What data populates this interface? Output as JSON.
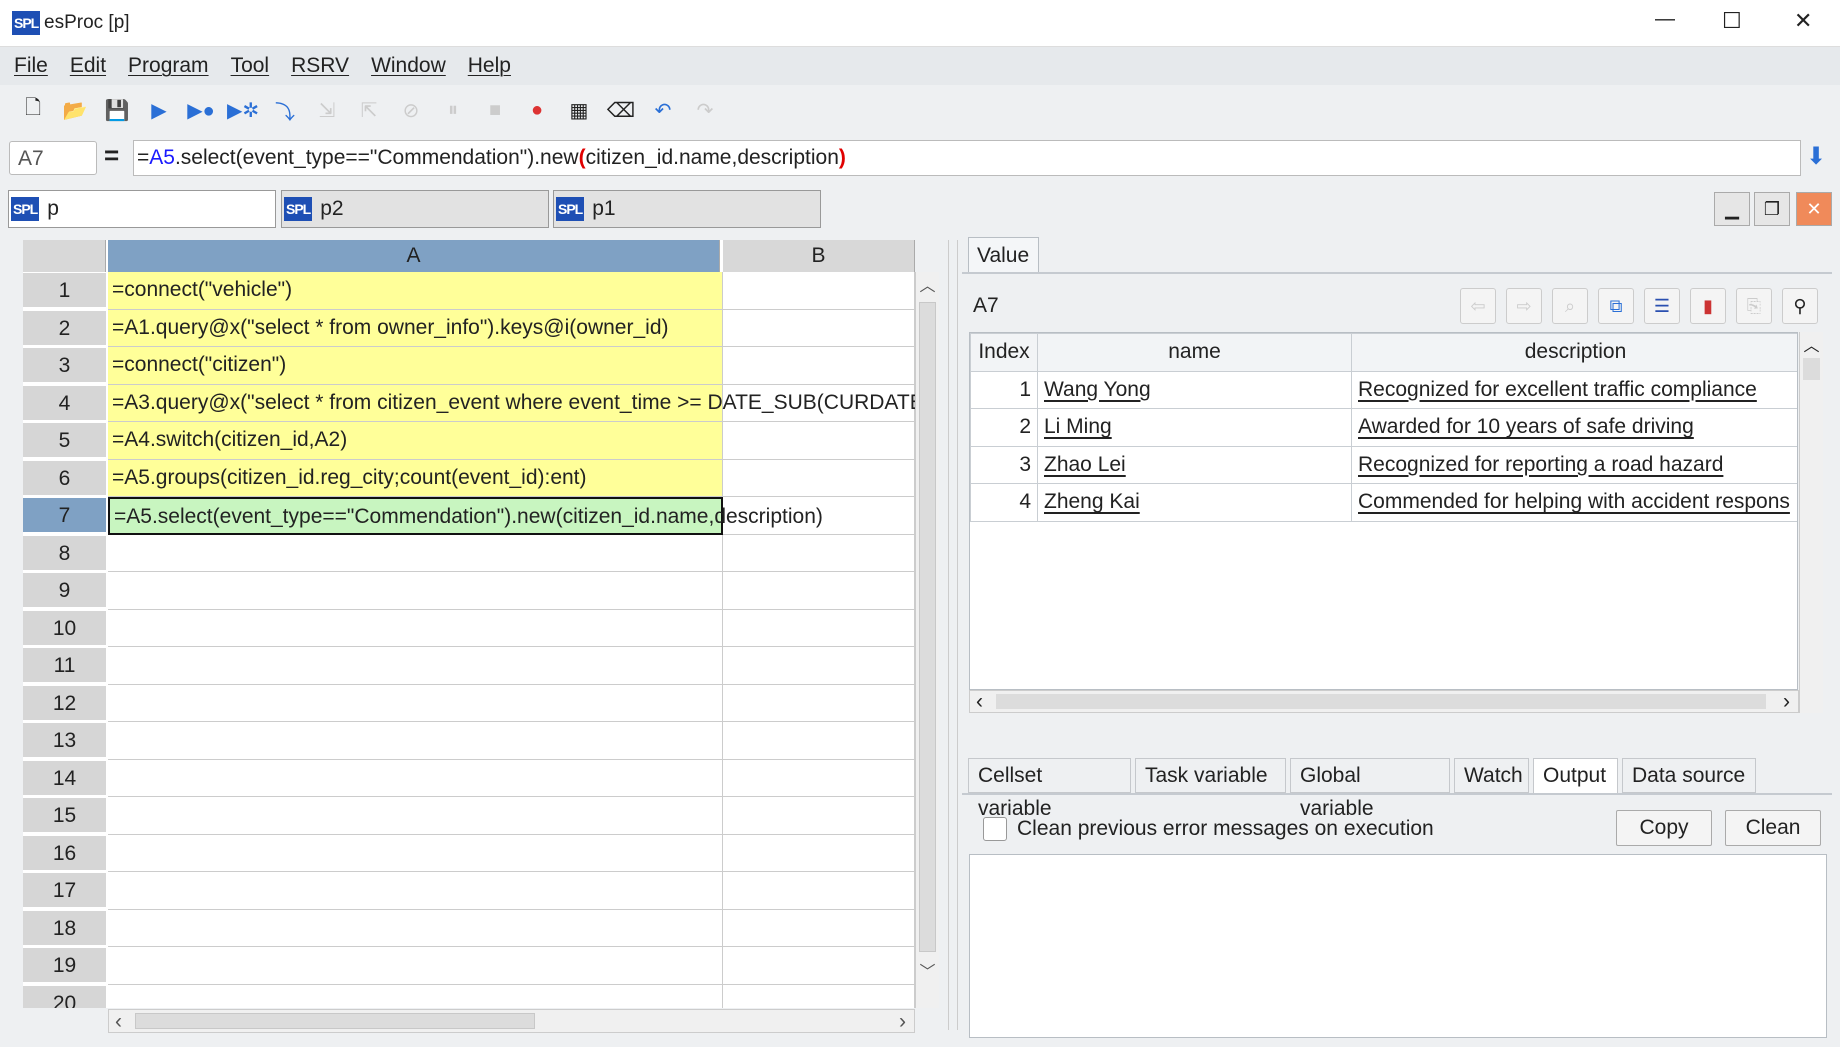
{
  "window": {
    "title": "esProc  [p]",
    "minimize": "—",
    "maximize": "☐",
    "close": "✕"
  },
  "menu": [
    "File",
    "Edit",
    "Program",
    "Tool",
    "RSRV",
    "Window",
    "Help"
  ],
  "toolbar": [
    {
      "icon": "new-file-icon",
      "g": "🗋"
    },
    {
      "icon": "open-folder-icon",
      "g": "📂"
    },
    {
      "icon": "save-icon",
      "g": "💾"
    },
    {
      "icon": "run-icon",
      "g": "▶"
    },
    {
      "icon": "debug-icon",
      "g": "▶●"
    },
    {
      "icon": "run-to-cursor-icon",
      "g": "▶✲"
    },
    {
      "icon": "step-into-icon",
      "g": "⤵"
    },
    {
      "icon": "step-over-icon",
      "g": "⇲"
    },
    {
      "icon": "step-out-icon",
      "g": "⇱"
    },
    {
      "icon": "stop-icon",
      "g": "⊘"
    },
    {
      "icon": "pause-icon",
      "g": "⏸"
    },
    {
      "icon": "stop-square-icon",
      "g": "■"
    },
    {
      "icon": "breakpoint-icon",
      "g": "●"
    },
    {
      "icon": "calculator-icon",
      "g": "▦"
    },
    {
      "icon": "eraser-icon",
      "g": "⌫"
    },
    {
      "icon": "undo-icon",
      "g": "↶"
    },
    {
      "icon": "redo-icon",
      "g": "↷"
    }
  ],
  "formula": {
    "cell": "A7",
    "eq": "=",
    "prefix": "=",
    "ref": "A5",
    "middle": ".select(event_type==\"Commendation\").new",
    "paren_open": "(",
    "args": "citizen_id.name,description",
    "paren_close": ")"
  },
  "tabs": [
    {
      "label": "p"
    },
    {
      "label": "p2"
    },
    {
      "label": "p1"
    }
  ],
  "spl_badge": "SPL",
  "grid": {
    "columns": [
      "A",
      "B"
    ],
    "rows": [
      "1",
      "2",
      "3",
      "4",
      "5",
      "6",
      "7",
      "8",
      "9",
      "10",
      "11",
      "12",
      "13",
      "14",
      "15",
      "16",
      "17",
      "18",
      "19",
      "20"
    ],
    "cells": [
      "=connect(\"vehicle\")",
      "=A1.query@x(\"select * from owner_info\").keys@i(owner_id)",
      "=connect(\"citizen\")",
      "=A3.query@x(\"select * from citizen_event where event_time >= DATE_SUB(CURDATE",
      "=A4.switch(citizen_id,A2)",
      "=A5.groups(citizen_id.reg_city;count(event_id):ent)",
      "=A5.select(event_type==\"Commendation\").new(citizen_id.name,description)"
    ],
    "selected": "A7"
  },
  "value_panel": {
    "tab": "Value",
    "cell": "A7",
    "columns": [
      "Index",
      "name",
      "description"
    ],
    "rows": [
      [
        "1",
        "Wang Yong",
        "Recognized for excellent traffic compliance"
      ],
      [
        "2",
        "Li Ming",
        "Awarded for 10 years of safe driving"
      ],
      [
        "3",
        "Zhao Lei",
        "Recognized for reporting a road hazard"
      ],
      [
        "4",
        "Zheng Kai",
        "Commended for helping with accident respons"
      ]
    ]
  },
  "bottom_tabs": [
    "Cellset variable",
    "Task variable",
    "Global variable",
    "Watch",
    "Output",
    "Data source"
  ],
  "active_bottom_tab": "Output",
  "output": {
    "checkbox_label": "Clean previous error messages on execution",
    "checked": false,
    "copy": "Copy",
    "clean": "Clean"
  },
  "colors": {
    "cell_yellow": "#ffff99",
    "cell_selected": "#c8f5c0",
    "header_selected": "#7fa1c4",
    "ref_blue": "#1a1aff",
    "paren_red": "#e00000"
  }
}
